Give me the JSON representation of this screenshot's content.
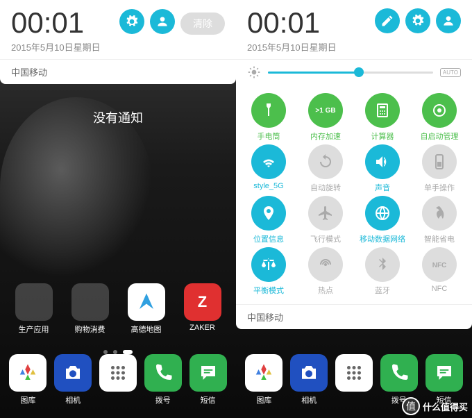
{
  "left": {
    "time": "00:01",
    "date": "2015年5月10日星期日",
    "clear_label": "清除",
    "carrier": "中国移动",
    "no_notif": "没有通知",
    "mid_apps": [
      {
        "label": "生产应用",
        "type": "folder",
        "colors": [
          "#f0a020",
          "#d04040",
          "#40a060",
          "#4060d0"
        ]
      },
      {
        "label": "购物消费",
        "type": "folder",
        "colors": [
          "#e04020",
          "#e08020",
          "#2080c0",
          "#c02060"
        ]
      },
      {
        "label": "高德地图",
        "bg": "#ffffff",
        "icon": "nav"
      },
      {
        "label": "ZAKER",
        "bg": "#e03030",
        "text": "Z"
      }
    ],
    "dock": [
      {
        "label": "图库",
        "bg": "#ffffff",
        "icon": "gallery"
      },
      {
        "label": "相机",
        "bg": "#2050c0",
        "icon": "camera"
      },
      {
        "label": "拨号",
        "bg": "#30b050",
        "icon": "phone"
      },
      {
        "label": "短信",
        "bg": "#30b050",
        "icon": "sms"
      }
    ]
  },
  "right": {
    "time": "00:01",
    "date": "2015年5月10日星期日",
    "carrier": "中国移动",
    "brightness_pct": 55,
    "auto_label": "AUTO",
    "qs": [
      {
        "label": "手电筒",
        "state": "green",
        "icon": "flashlight"
      },
      {
        "label": "内存加速",
        "state": "green",
        "icon": "memory",
        "text": ">1 GB"
      },
      {
        "label": "计算器",
        "state": "green",
        "icon": "calc"
      },
      {
        "label": "自启动管理",
        "state": "green",
        "icon": "autostart"
      },
      {
        "label": "style_5G",
        "state": "cyan",
        "icon": "wifi"
      },
      {
        "label": "自动旋转",
        "state": "gray",
        "icon": "rotate"
      },
      {
        "label": "声音",
        "state": "cyan",
        "icon": "sound"
      },
      {
        "label": "单手操作",
        "state": "gray",
        "icon": "onehand"
      },
      {
        "label": "位置信息",
        "state": "cyan",
        "icon": "location"
      },
      {
        "label": "飞行模式",
        "state": "gray",
        "icon": "airplane"
      },
      {
        "label": "移动数据网络",
        "state": "cyan",
        "icon": "data"
      },
      {
        "label": "智能省电",
        "state": "gray",
        "icon": "power"
      },
      {
        "label": "平衡模式",
        "state": "cyan",
        "icon": "balance"
      },
      {
        "label": "热点",
        "state": "gray",
        "icon": "hotspot"
      },
      {
        "label": "蓝牙",
        "state": "gray",
        "icon": "bluetooth"
      },
      {
        "label": "NFC",
        "state": "gray",
        "icon": "nfc"
      }
    ],
    "dock": [
      {
        "label": "图库",
        "bg": "#ffffff",
        "icon": "gallery"
      },
      {
        "label": "相机",
        "bg": "#2050c0",
        "icon": "camera"
      },
      {
        "label": "拨号",
        "bg": "#30b050",
        "icon": "phone"
      },
      {
        "label": "短信",
        "bg": "#30b050",
        "icon": "sms"
      }
    ]
  },
  "apps_icon": "⋮⋮⋮",
  "watermark": {
    "badge": "值",
    "text": "什么值得买"
  }
}
